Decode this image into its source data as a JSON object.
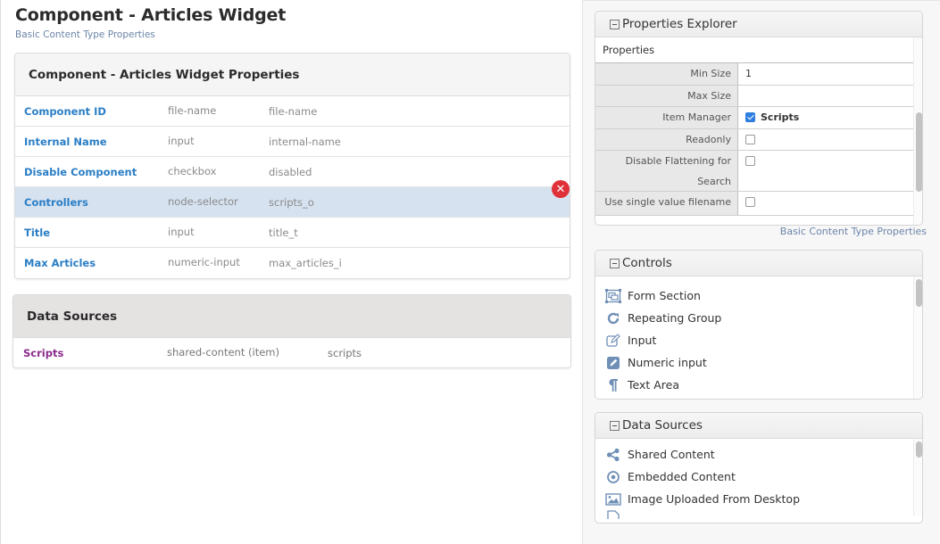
{
  "page": {
    "title": "Component - Articles Widget",
    "subtitle": "Basic Content Type Properties"
  },
  "properties_panel": {
    "heading": "Component - Articles Widget Properties",
    "rows": [
      {
        "name": "Component ID",
        "type": "file-name",
        "id": "file-name",
        "selected": false
      },
      {
        "name": "Internal Name",
        "type": "input",
        "id": "internal-name",
        "selected": false
      },
      {
        "name": "Disable Component",
        "type": "checkbox",
        "id": "disabled",
        "selected": false
      },
      {
        "name": "Controllers",
        "type": "node-selector",
        "id": "scripts_o",
        "selected": true
      },
      {
        "name": "Title",
        "type": "input",
        "id": "title_t",
        "selected": false
      },
      {
        "name": "Max Articles",
        "type": "numeric-input",
        "id": "max_articles_i",
        "selected": false
      }
    ],
    "delete_icon": "close-circle-icon"
  },
  "data_sources_panel": {
    "heading": "Data Sources",
    "rows": [
      {
        "name": "Scripts",
        "type": "shared-content (item)",
        "id": "scripts"
      }
    ]
  },
  "properties_explorer": {
    "heading": "Properties Explorer",
    "subheading": "Properties",
    "rows": [
      {
        "label": "Min Size",
        "value": "1",
        "kind": "text"
      },
      {
        "label": "Max Size",
        "value": "",
        "kind": "text"
      },
      {
        "label": "Item Manager",
        "value": "Scripts",
        "kind": "checkbox",
        "checked": true
      },
      {
        "label": "Readonly",
        "value": "",
        "kind": "checkbox",
        "checked": false
      },
      {
        "label": "Disable Flattening for Search",
        "value": "",
        "kind": "checkbox",
        "checked": false
      },
      {
        "label": "Use single value filename",
        "value": "",
        "kind": "checkbox",
        "checked": false
      }
    ],
    "footer_link": "Basic Content Type Properties"
  },
  "controls": {
    "heading": "Controls",
    "items": [
      {
        "label": "Form Section",
        "icon": "form-section-icon"
      },
      {
        "label": "Repeating Group",
        "icon": "repeat-icon"
      },
      {
        "label": "Input",
        "icon": "edit-outline-icon"
      },
      {
        "label": "Numeric input",
        "icon": "edit-filled-icon"
      },
      {
        "label": "Text Area",
        "icon": "paragraph-icon"
      }
    ]
  },
  "data_sources_list": {
    "heading": "Data Sources",
    "items": [
      {
        "label": "Shared Content",
        "icon": "share-icon"
      },
      {
        "label": "Embedded Content",
        "icon": "target-icon"
      },
      {
        "label": "Image Uploaded From Desktop",
        "icon": "image-icon"
      }
    ]
  },
  "colors": {
    "link_blue": "#2a7ec6",
    "datasource_purple": "#8c2b8c",
    "selected_row": "#d6e2f0",
    "delete_red": "#e0313b",
    "icon_blue": "#6f8fb6",
    "checkbox_blue": "#2f7fe0"
  }
}
